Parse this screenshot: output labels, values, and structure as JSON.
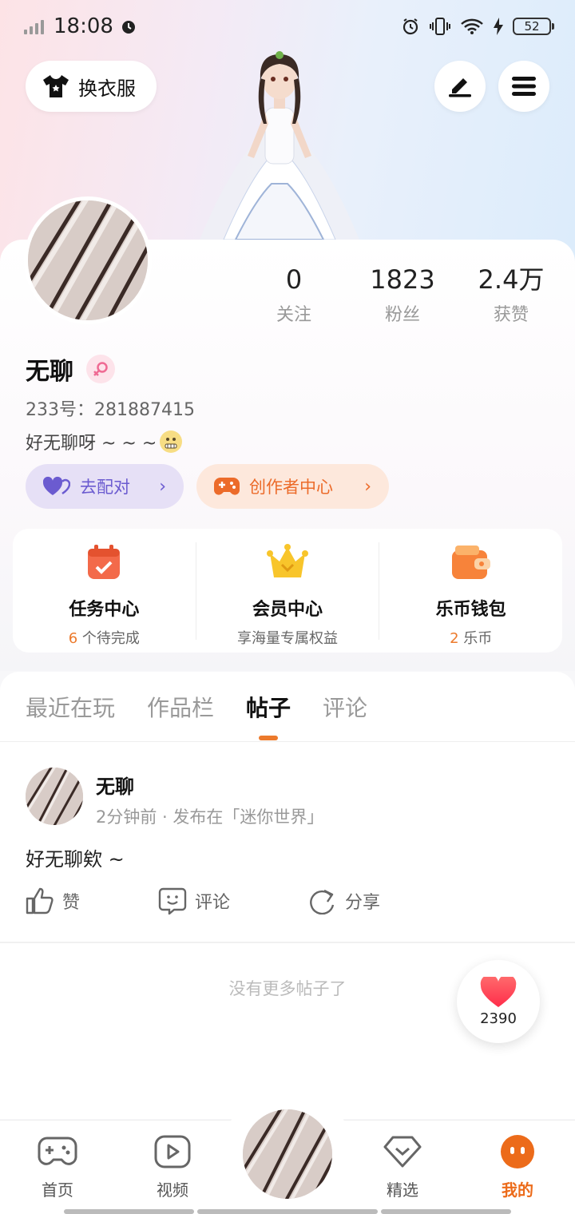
{
  "status_bar": {
    "time": "18:08",
    "battery": "52"
  },
  "header": {
    "outfit_label": "换衣服"
  },
  "stats": [
    {
      "value": "0",
      "label": "关注"
    },
    {
      "value": "1823",
      "label": "粉丝"
    },
    {
      "value": "2.4万",
      "label": "获赞"
    }
  ],
  "profile": {
    "name": "无聊",
    "uid": "233号：281887415",
    "bio": "好无聊呀 ~ ~ ~"
  },
  "pills": {
    "match": "去配对",
    "creator": "创作者中心"
  },
  "services": [
    {
      "title": "任务中心",
      "highlight": "6",
      "sub": " 个待完成"
    },
    {
      "title": "会员中心",
      "highlight": "",
      "sub": "享海量专属权益"
    },
    {
      "title": "乐币钱包",
      "highlight": "2",
      "sub": " 乐币"
    }
  ],
  "tabs": [
    "最近在玩",
    "作品栏",
    "帖子",
    "评论"
  ],
  "post": {
    "author": "无聊",
    "meta": "2分钟前 · 发布在「迷你世界」",
    "text": "好无聊欸 ~",
    "actions": {
      "like": "赞",
      "comment": "评论",
      "share": "分享"
    }
  },
  "no_more_text": "没有更多帖子了",
  "like_float_count": "2390",
  "nav": {
    "home": "首页",
    "video": "视频",
    "featured": "精选",
    "mine": "我的"
  },
  "colors": {
    "accent": "#ec7a2c",
    "match": "#6b5bd0"
  }
}
